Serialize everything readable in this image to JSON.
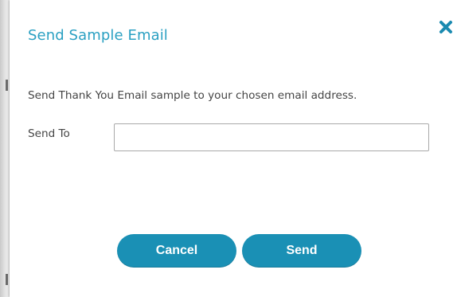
{
  "dialog": {
    "title": "Send Sample Email",
    "description": "Send Thank You Email sample to your chosen email address.",
    "send_to_label": "Send To",
    "send_to_value": "",
    "send_to_placeholder": "",
    "cancel_label": "Cancel",
    "send_label": "Send",
    "close_icon": "close-x-icon"
  },
  "colors": {
    "title": "#2aa0c2",
    "accent_button": "#1a90b5",
    "close_icon": "#1a8ab0",
    "text": "#444444"
  }
}
